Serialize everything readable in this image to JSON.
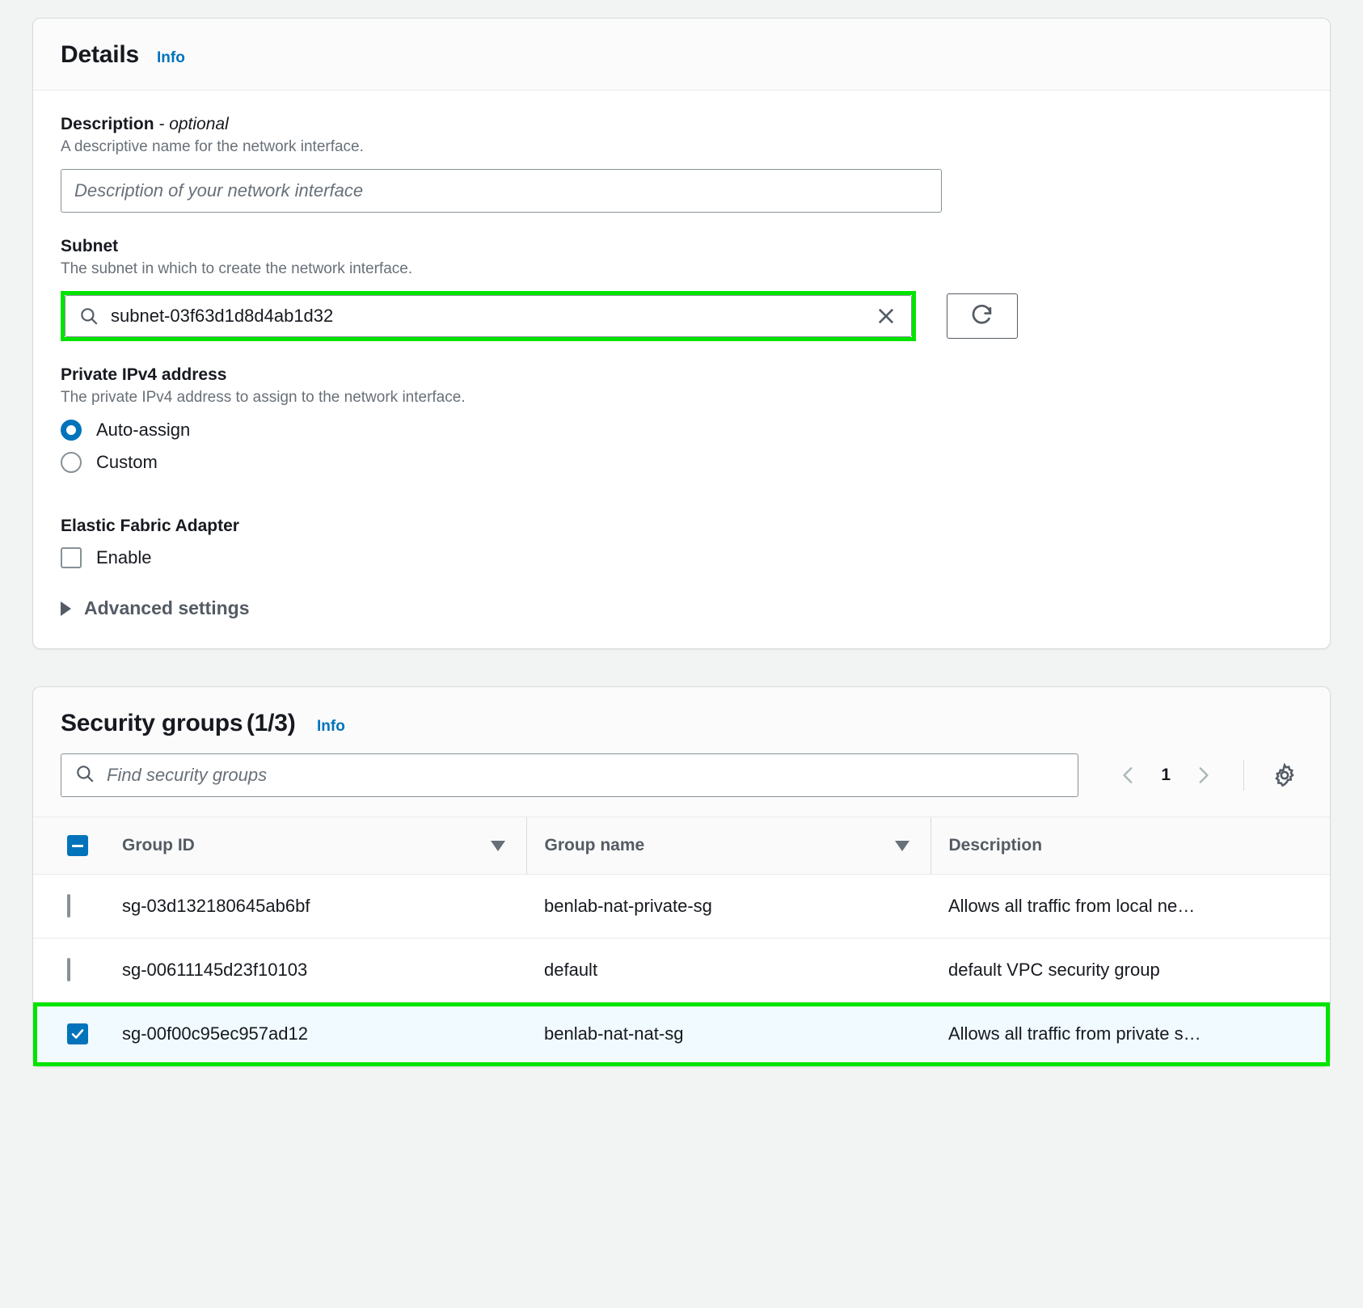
{
  "details": {
    "title": "Details",
    "info_label": "Info",
    "description": {
      "label": "Description",
      "optional_suffix": "- optional",
      "help": "A descriptive name for the network interface.",
      "placeholder": "Description of your network interface",
      "value": ""
    },
    "subnet": {
      "label": "Subnet",
      "help": "The subnet in which to create the network interface.",
      "value": "subnet-03f63d1d8d4ab1d32",
      "search_icon": "search-icon",
      "clear_icon": "close-icon",
      "refresh_icon": "refresh-icon",
      "highlighted": true
    },
    "private_ipv4": {
      "label": "Private IPv4 address",
      "help": "The private IPv4 address to assign to the network interface.",
      "options": [
        {
          "label": "Auto-assign",
          "selected": true
        },
        {
          "label": "Custom",
          "selected": false
        }
      ]
    },
    "efa": {
      "label": "Elastic Fabric Adapter",
      "checkbox_label": "Enable",
      "checked": false
    },
    "advanced": {
      "label": "Advanced settings",
      "expanded": false,
      "caret_icon": "chevron-right-icon"
    }
  },
  "security_groups": {
    "title": "Security groups",
    "count": "(1/3)",
    "info_label": "Info",
    "search_placeholder": "Find security groups",
    "search_value": "",
    "pagination": {
      "prev_icon": "chevron-left-icon",
      "page": "1",
      "next_icon": "chevron-right-icon",
      "settings_icon": "gear-icon"
    },
    "columns": [
      "Group ID",
      "Group name",
      "Description"
    ],
    "header_checkbox_state": "indeterminate",
    "rows": [
      {
        "selected": false,
        "highlighted": false,
        "group_id": "sg-03d132180645ab6bf",
        "group_name": "benlab-nat-private-sg",
        "description": "Allows all traffic from local ne…"
      },
      {
        "selected": false,
        "highlighted": false,
        "group_id": "sg-00611145d23f10103",
        "group_name": "default",
        "description": "default VPC security group"
      },
      {
        "selected": true,
        "highlighted": true,
        "group_id": "sg-00f00c95ec957ad12",
        "group_name": "benlab-nat-nat-sg",
        "description": "Allows all traffic from private s…"
      }
    ]
  },
  "colors": {
    "accent": "#0073bb",
    "highlight": "#00e400",
    "selected_row": "#f1faff",
    "text": "#16191f",
    "muted": "#687078"
  }
}
